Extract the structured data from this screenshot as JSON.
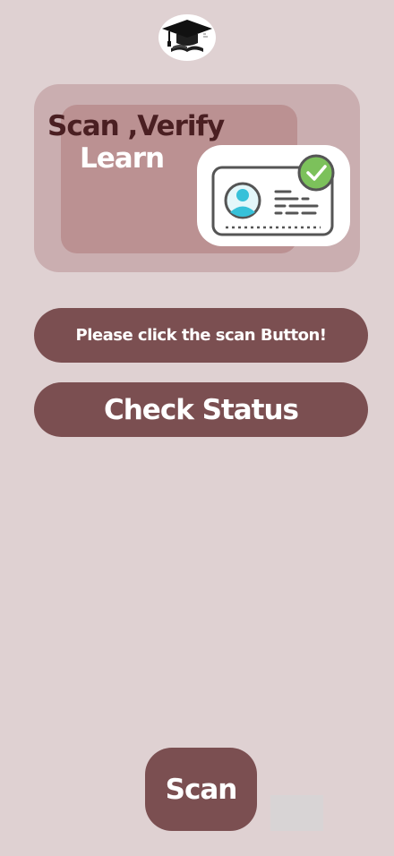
{
  "logo": {
    "icon": "graduation-cap-book-icon"
  },
  "hero": {
    "title": "Scan ,Verify",
    "subtitle": "Learn",
    "illustration": "verified-id-card-icon"
  },
  "instruction_button": {
    "label": "Please click the scan Button!"
  },
  "status_button": {
    "label": "Check Status"
  },
  "scan_button": {
    "label": "Scan"
  },
  "colors": {
    "background": "#dfd1d2",
    "hero_outer": "#caaeb0",
    "hero_inner": "#bb9192",
    "button": "#7b4f51",
    "title_dark": "#4a1f22",
    "check_green": "#7cc15b",
    "avatar_cyan": "#37c1d9"
  }
}
